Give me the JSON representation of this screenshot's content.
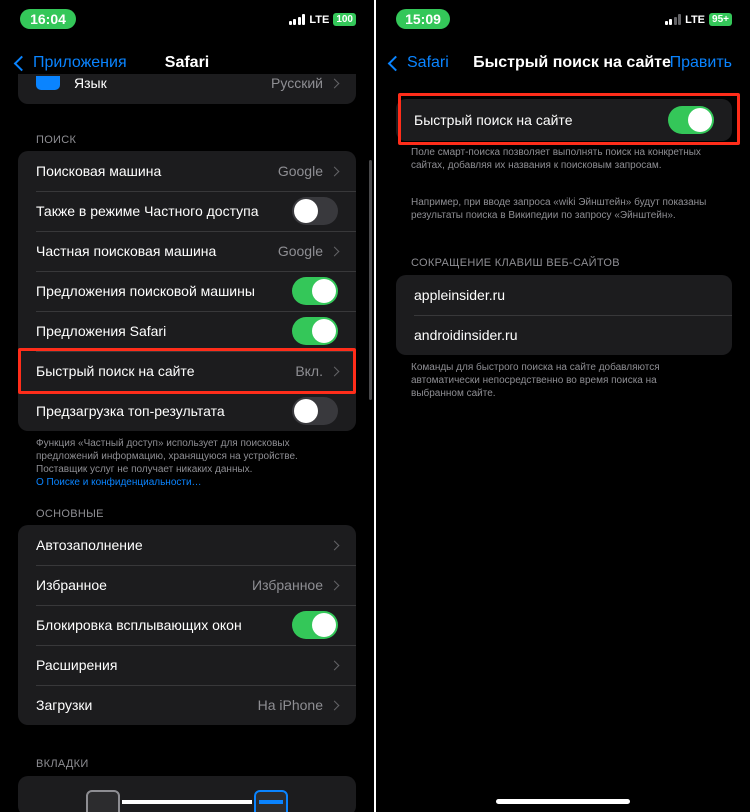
{
  "left": {
    "status": {
      "time": "16:04",
      "network": "LTE",
      "battery": "100"
    },
    "nav": {
      "back_label": "Приложения",
      "title": "Safari"
    },
    "language_row": {
      "label": "Язык",
      "value": "Русский"
    },
    "search_section": {
      "header": "ПОИСК",
      "rows": [
        {
          "label": "Поисковая машина",
          "value": "Google"
        },
        {
          "label": "Также в режиме Частного доступа",
          "toggle": "off"
        },
        {
          "label": "Частная поисковая машина",
          "value": "Google"
        },
        {
          "label": "Предложения поисковой машины",
          "toggle": "on"
        },
        {
          "label": "Предложения Safari",
          "toggle": "on"
        },
        {
          "label": "Быстрый поиск на сайте",
          "value": "Вкл."
        },
        {
          "label": "Предзагрузка топ-результата",
          "toggle": "off"
        }
      ],
      "footnote": "Функция «Частный доступ» использует для поисковых предложений информацию, хранящуюся на устройстве. Поставщик услуг не получает никаких данных.",
      "footnote_link": "О Поиске и конфиденциальности…"
    },
    "general_section": {
      "header": "ОСНОВНЫЕ",
      "rows": [
        {
          "label": "Автозаполнение",
          "value": ""
        },
        {
          "label": "Избранное",
          "value": "Избранное"
        },
        {
          "label": "Блокировка всплывающих окон",
          "toggle": "on"
        },
        {
          "label": "Расширения",
          "value": ""
        },
        {
          "label": "Загрузки",
          "value": "На iPhone"
        }
      ]
    },
    "tabs_section": {
      "header": "ВКЛАДКИ"
    }
  },
  "right": {
    "status": {
      "time": "15:09",
      "network": "LTE",
      "battery": "95+"
    },
    "nav": {
      "back_label": "Safari",
      "title": "Быстрый поиск на сайте",
      "action": "Править"
    },
    "toggle_row": {
      "label": "Быстрый поиск на сайте",
      "toggle": "on"
    },
    "description_1": "Поле смарт-поиска позволяет выполнять поиск на конкретных сайтах, добавляя их названия к поисковым запросам.",
    "description_2": "Например, при вводе запроса «wiki Эйнштейн» будут показаны результаты поиска в Википедии по запросу «Эйнштейн».",
    "shortcuts_section": {
      "header": "СОКРАЩЕНИЕ КЛАВИШ ВЕБ-САЙТОВ",
      "sites": [
        "appleinsider.ru",
        "androidinsider.ru"
      ],
      "footnote": "Команды для быстрого поиска на сайте добавляются автоматически непосредственно во время поиска на выбранном сайте."
    }
  },
  "colors": {
    "accent": "#0a84ff",
    "toggle_on": "#34c759",
    "highlight": "#ff2d1a",
    "cell": "#1c1c1e"
  }
}
